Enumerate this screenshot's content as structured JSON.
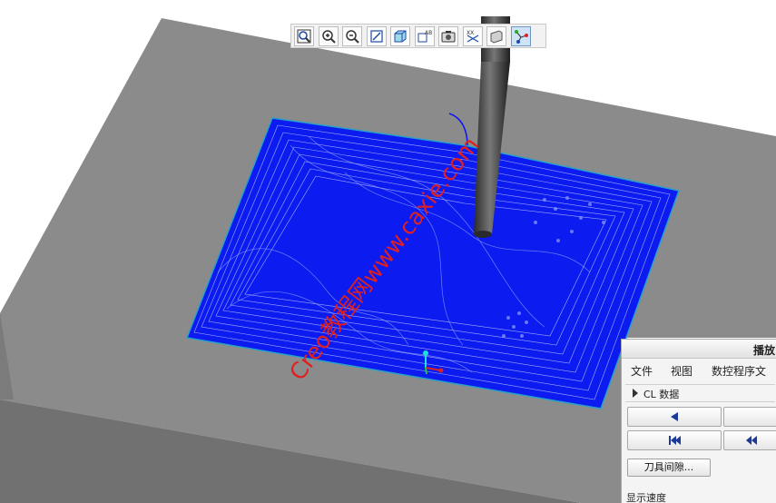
{
  "scene": {
    "colors": {
      "background": "#ffffff",
      "block_top": "#8b8b8b",
      "block_side": "#6e6e6e",
      "toolpath": "#0a14f2",
      "tool": "#444444"
    },
    "watermark": "Creo教程网www.caxie.com"
  },
  "toolbar": {
    "buttons": [
      {
        "name": "zoom-fit-button",
        "icon": "zoom-fit-icon"
      },
      {
        "name": "zoom-in-button",
        "icon": "zoom-in-icon"
      },
      {
        "name": "zoom-out-button",
        "icon": "zoom-out-icon"
      },
      {
        "name": "repaint-button",
        "icon": "repaint-icon"
      },
      {
        "name": "display-style-button",
        "icon": "shaded-cube-icon"
      },
      {
        "name": "saved-views-button",
        "icon": "named-view-icon"
      },
      {
        "name": "view-manager-button",
        "icon": "view-manager-icon"
      },
      {
        "name": "annotation-display-button",
        "icon": "datum-display-icon"
      },
      {
        "name": "orient-button",
        "icon": "orient-plane-icon"
      },
      {
        "name": "toolpath-display-button",
        "icon": "toolpath-node-icon",
        "active": true
      }
    ]
  },
  "playback": {
    "title": "播放",
    "menu": [
      "文件",
      "视图",
      "数控程序文"
    ],
    "cl_section": "CL 数据",
    "clearance_button": "刀具间隙...",
    "speed_label": "显示速度"
  }
}
